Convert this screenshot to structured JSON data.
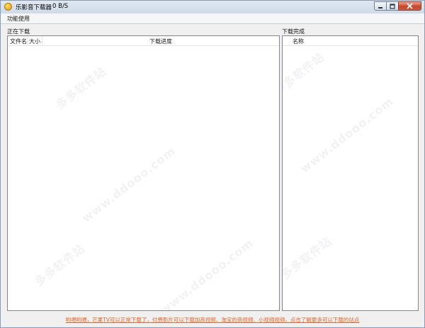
{
  "window": {
    "title": "乐影音下载器",
    "speed": "0 B/S"
  },
  "menu": {
    "items": [
      "功能使用"
    ]
  },
  "downloading": {
    "label": "正在下载",
    "columns": [
      "文件名",
      "大小",
      "下载进度"
    ],
    "rows": []
  },
  "completed": {
    "label": "下载完成",
    "columns": [
      "名称"
    ],
    "rows": []
  },
  "footer": {
    "link_text": "哟喂哟喂，芒果TV可以正常下载了，付费影片可以下载加高视频、淘宝的商视频、小视频视频，点击了解更多可以下载的站点"
  },
  "watermark": {
    "text_cn": "多多软件站",
    "text_url": "www.ddooo.com"
  },
  "colors": {
    "footer_link": "#e0662d",
    "close_button": "#c7432c",
    "titlebar": "#d6e1ee"
  }
}
